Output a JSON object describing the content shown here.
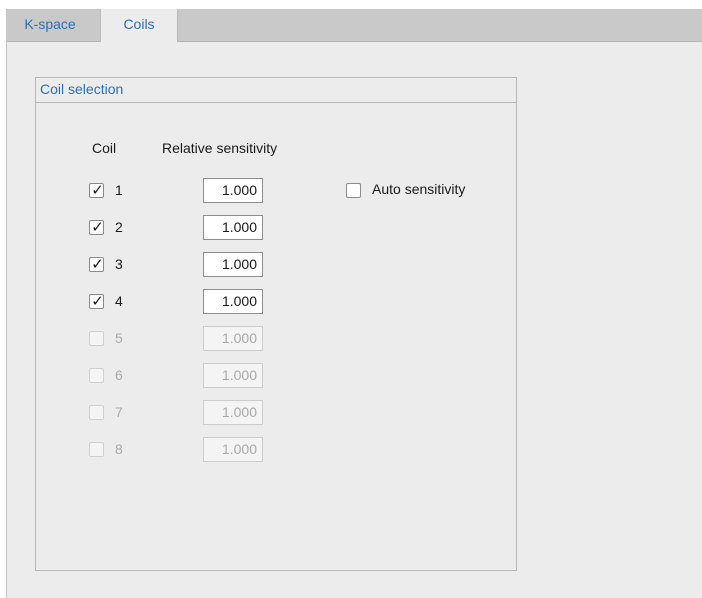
{
  "tabs": [
    {
      "label": "K-space",
      "active": false
    },
    {
      "label": "Coils",
      "active": true
    }
  ],
  "coil_selection": {
    "title": "Coil selection",
    "col_coil": "Coil",
    "col_sensitivity": "Relative sensitivity",
    "auto_sensitivity": {
      "label": "Auto sensitivity",
      "checked": false
    },
    "coils": [
      {
        "number": "1",
        "checked": true,
        "enabled": true,
        "sensitivity": "1.000"
      },
      {
        "number": "2",
        "checked": true,
        "enabled": true,
        "sensitivity": "1.000"
      },
      {
        "number": "3",
        "checked": true,
        "enabled": true,
        "sensitivity": "1.000"
      },
      {
        "number": "4",
        "checked": true,
        "enabled": true,
        "sensitivity": "1.000"
      },
      {
        "number": "5",
        "checked": false,
        "enabled": false,
        "sensitivity": "1.000"
      },
      {
        "number": "6",
        "checked": false,
        "enabled": false,
        "sensitivity": "1.000"
      },
      {
        "number": "7",
        "checked": false,
        "enabled": false,
        "sensitivity": "1.000"
      },
      {
        "number": "8",
        "checked": false,
        "enabled": false,
        "sensitivity": "1.000"
      }
    ]
  },
  "colors": {
    "accent": "#2a6fb5",
    "panel": "#ececec",
    "tabbar": "#c9c9c9"
  }
}
